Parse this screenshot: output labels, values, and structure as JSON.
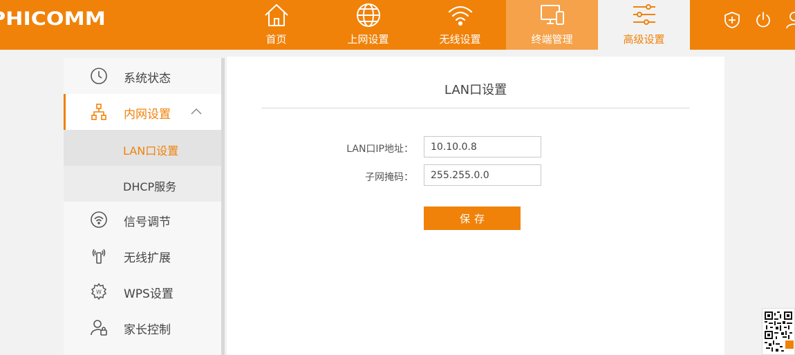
{
  "brand": {
    "logo_text": "PHICOMM"
  },
  "colors": {
    "accent": "#f0820a",
    "nav_hover": "#f5a24a",
    "background": "#f2f2f2"
  },
  "nav": {
    "items": [
      {
        "label": "首页",
        "icon": "home-icon"
      },
      {
        "label": "上网设置",
        "icon": "globe-icon"
      },
      {
        "label": "无线设置",
        "icon": "wifi-icon"
      },
      {
        "label": "终端管理",
        "icon": "devices-icon"
      },
      {
        "label": "高级设置",
        "icon": "sliders-icon"
      }
    ],
    "active_index": 4
  },
  "top_icons": [
    "shield-plus-icon",
    "power-icon",
    "user-icon"
  ],
  "sidebar": {
    "items": [
      {
        "label": "系统状态",
        "icon": "clock-icon"
      },
      {
        "label": "内网设置",
        "icon": "network-icon",
        "expanded": true
      },
      {
        "label": "信号调节",
        "icon": "signal-icon"
      },
      {
        "label": "无线扩展",
        "icon": "antenna-icon"
      },
      {
        "label": "WPS设置",
        "icon": "wps-gear-icon"
      },
      {
        "label": "家长控制",
        "icon": "parent-control-icon"
      }
    ],
    "subitems": [
      {
        "label": "LAN口设置",
        "active": true
      },
      {
        "label": "DHCP服务",
        "active": false
      }
    ]
  },
  "panel": {
    "title": "LAN口设置",
    "lan_ip_label": "LAN口IP地址：",
    "lan_ip_value": "10.10.0.8",
    "subnet_label": "子网掩码：",
    "subnet_value": "255.255.0.0",
    "save_label": "保存"
  }
}
